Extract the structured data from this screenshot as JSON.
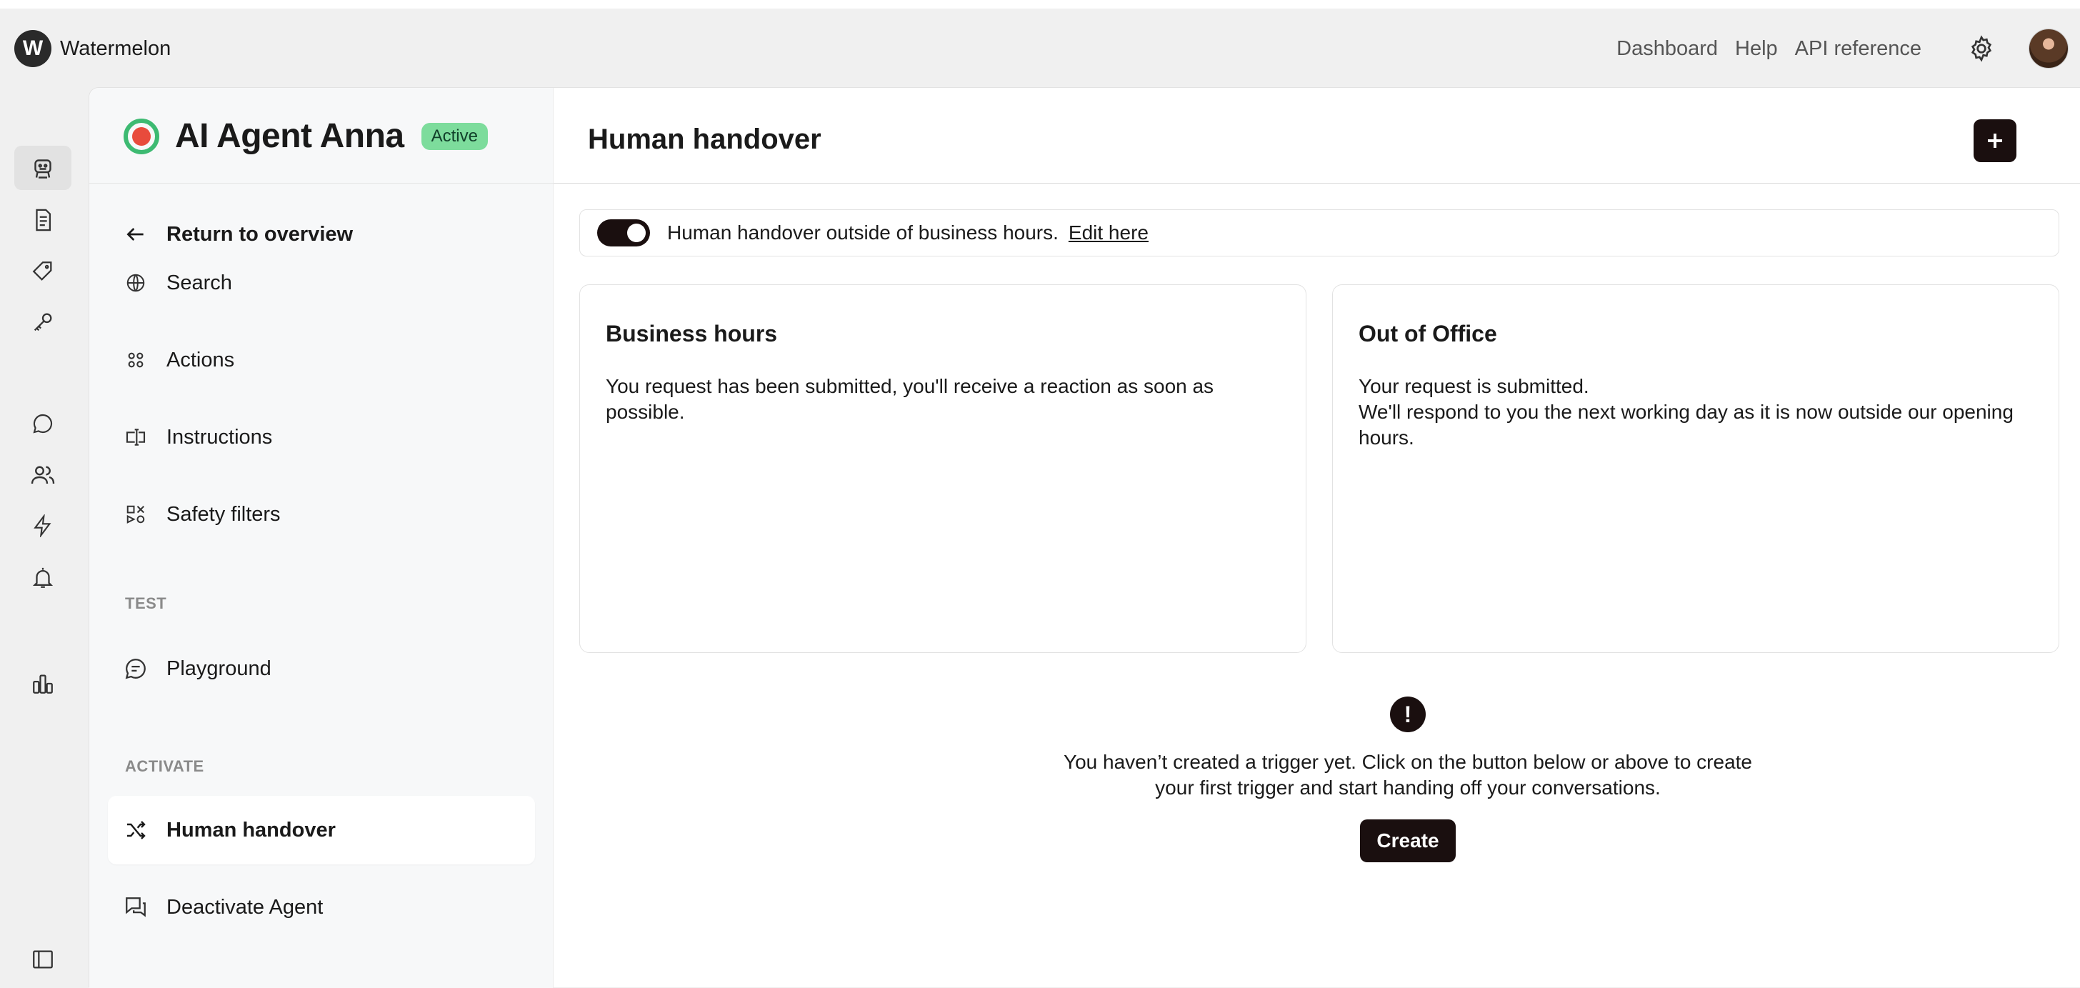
{
  "app": {
    "logo_letter": "W",
    "name": "Watermelon"
  },
  "topnav": {
    "dashboard": "Dashboard",
    "help": "Help",
    "api_reference": "API reference"
  },
  "agent": {
    "name": "AI Agent Anna",
    "status": "Active"
  },
  "sidebar": {
    "return_label": "Return to overview",
    "items": [
      {
        "label": "Search",
        "icon": "globe-icon"
      },
      {
        "label": "Actions",
        "icon": "grid-icon"
      },
      {
        "label": "Instructions",
        "icon": "text-cursor-icon"
      },
      {
        "label": "Safety filters",
        "icon": "shapes-icon"
      }
    ],
    "sections": {
      "test": "TEST",
      "activate": "ACTIVATE"
    },
    "test_items": [
      {
        "label": "Playground",
        "icon": "chat-bubble-icon"
      }
    ],
    "activate_items": [
      {
        "label": "Human handover",
        "icon": "shuffle-icon",
        "selected": true
      },
      {
        "label": "Deactivate Agent",
        "icon": "messages-icon"
      }
    ]
  },
  "main": {
    "title": "Human handover",
    "toggle": {
      "enabled": true,
      "text": "Human handover outside of business hours.",
      "link": "Edit here"
    },
    "cards": [
      {
        "title": "Business hours",
        "body": "You request has been submitted, you'll receive a reaction as soon as possible."
      },
      {
        "title": "Out of Office",
        "body": "Your request is submitted.\nWe'll respond to you the next working day as it is now outside our opening hours."
      }
    ],
    "empty_state": {
      "icon": "!",
      "text": "You haven’t created a trigger yet. Click on the button below or above to create\nyour first trigger and start handing off your conversations.",
      "button": "Create"
    }
  },
  "colors": {
    "accent_dark": "#1a0f0f",
    "active_badge": "#7ddc9c",
    "agent_logo_ring": "#3dba72",
    "agent_logo_fill": "#e84b3c"
  }
}
